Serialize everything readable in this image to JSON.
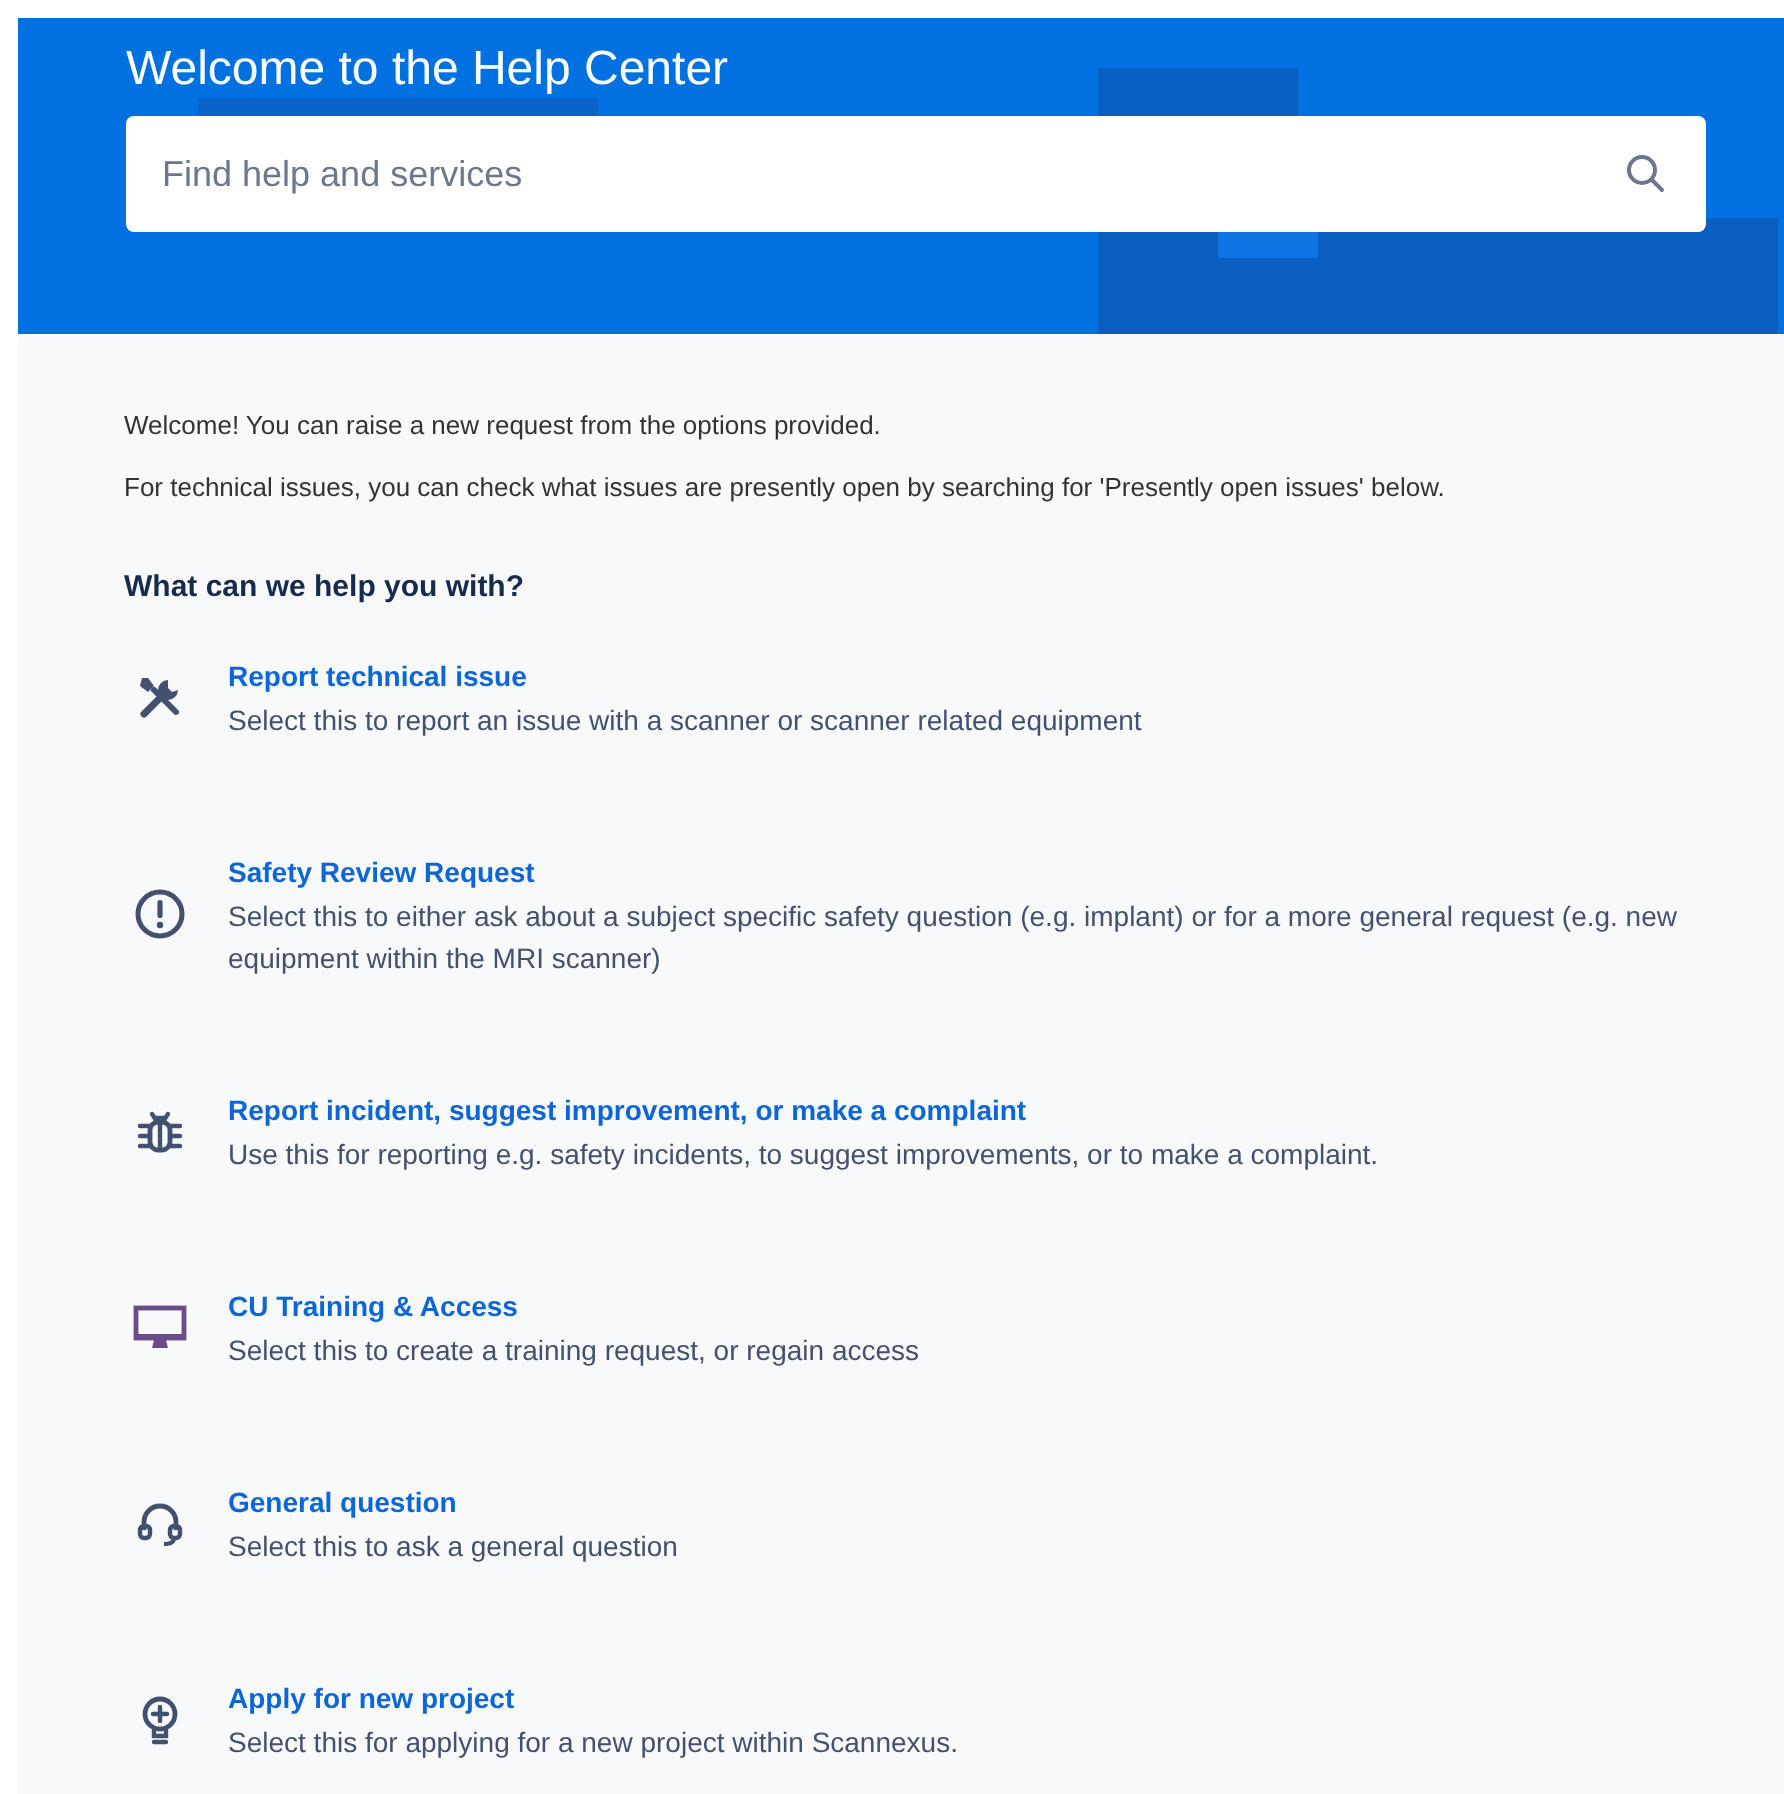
{
  "header": {
    "title": "Welcome to the Help Center",
    "search": {
      "placeholder": "Find help and services"
    }
  },
  "intro": [
    "Welcome! You can raise a new request from the options provided.",
    "For technical issues, you can check what issues are presently open by searching for 'Presently open issues' below."
  ],
  "section": {
    "heading": "What can we help you with?",
    "items": [
      {
        "title": "Report technical issue",
        "description": "Select this to report an issue with a scanner or scanner related equipment"
      },
      {
        "title": "Safety Review Request",
        "description": "Select this to either ask about a subject specific safety question (e.g. implant) or for a more general request (e.g. new equipment within the MRI scanner)"
      },
      {
        "title": "Report incident, suggest improvement, or make a complaint",
        "description": "Use this for reporting e.g. safety incidents, to suggest improvements, or to make a complaint."
      },
      {
        "title": "CU Training & Access",
        "description": "Select this to create a training request, or regain access"
      },
      {
        "title": "General question",
        "description": "Select this to ask a general question"
      },
      {
        "title": "Apply for new project",
        "description": "Select this for applying for a new project within Scannexus."
      }
    ]
  }
}
